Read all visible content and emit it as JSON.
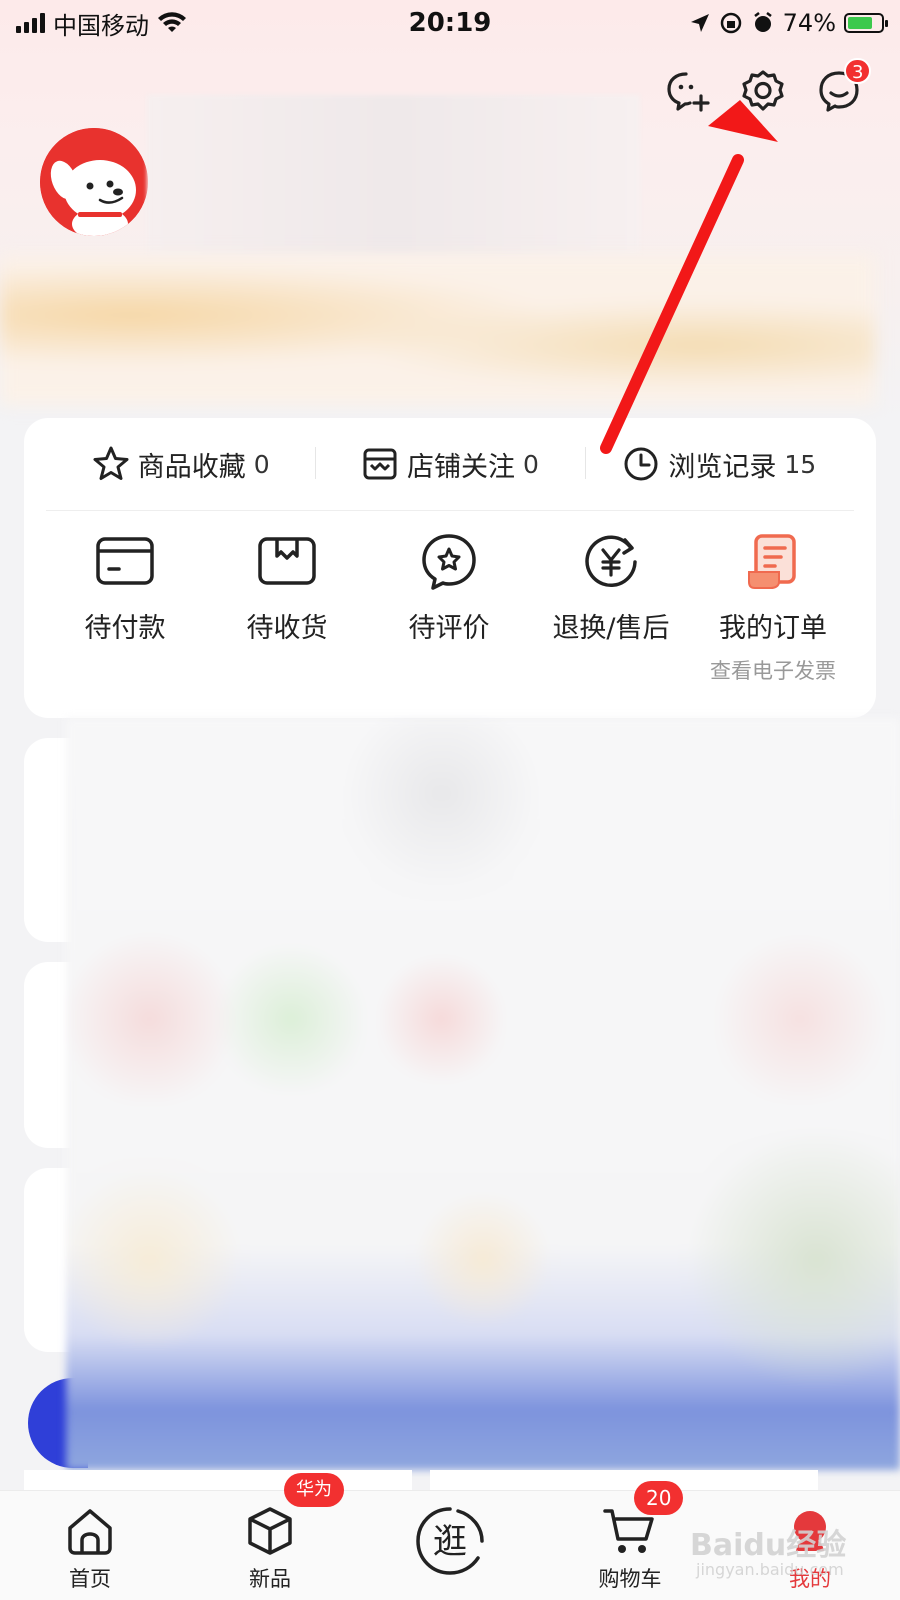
{
  "status_bar": {
    "carrier": "中国移动",
    "time": "20:19",
    "battery": "74%",
    "battery_level": 0.74
  },
  "header": {
    "message_badge": "3",
    "icons": [
      "add-friend-icon",
      "settings-gear-icon",
      "message-icon"
    ]
  },
  "quick_stats": [
    {
      "label": "商品收藏",
      "count": "0",
      "icon": "star-icon"
    },
    {
      "label": "店铺关注",
      "count": "0",
      "icon": "store-icon"
    },
    {
      "label": "浏览记录",
      "count": "15",
      "icon": "clock-icon"
    }
  ],
  "orders": [
    {
      "label": "待付款",
      "icon": "wallet-card-icon"
    },
    {
      "label": "待收货",
      "icon": "package-box-icon"
    },
    {
      "label": "待评价",
      "icon": "review-star-bubble-icon"
    },
    {
      "label": "退换/售后",
      "icon": "refund-yuan-icon"
    },
    {
      "label": "我的订单",
      "sub": "查看电子发票",
      "icon": "order-receipt-icon"
    }
  ],
  "tabbar": {
    "tabs": [
      {
        "label": "首页",
        "icon": "home-icon"
      },
      {
        "label": "新品",
        "icon": "new-cube-icon",
        "badge": "华为"
      },
      {
        "label": "",
        "icon": "guang-stroll-icon",
        "glyph": "逛"
      },
      {
        "label": "购物车",
        "icon": "cart-icon",
        "badge": "20"
      },
      {
        "label": "我的",
        "icon": "profile-icon",
        "active": true
      }
    ]
  },
  "watermark": {
    "text": "Baidu经验",
    "sub": "jingyan.baidu.com"
  },
  "colors": {
    "accent": "#e4393c",
    "annotation_arrow": "#f21818"
  }
}
